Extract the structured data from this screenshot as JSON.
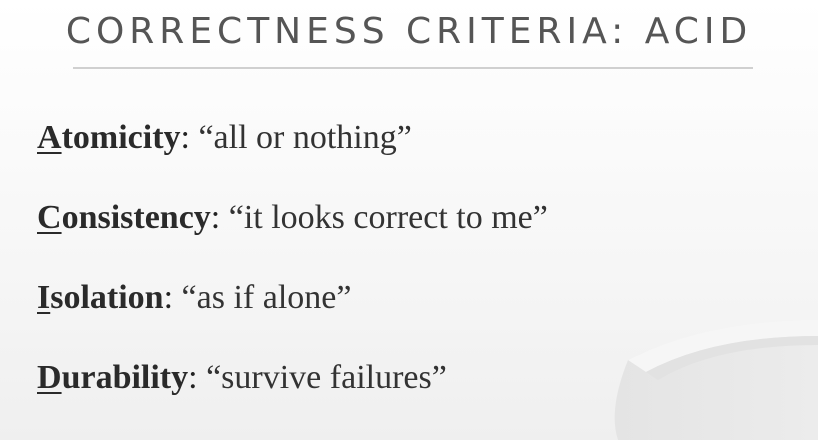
{
  "slide": {
    "title": "CORRECTNESS CRITERIA: ACID",
    "items": [
      {
        "initial": "A",
        "rest": "tomicity",
        "colon": ": ",
        "description": "“all or nothing”"
      },
      {
        "initial": "C",
        "rest": "onsistency",
        "colon": ": ",
        "description": "“it looks correct to me”"
      },
      {
        "initial": "I",
        "rest": "solation",
        "colon": ": ",
        "description": "“as if alone”"
      },
      {
        "initial": "D",
        "rest": "urability",
        "colon": ": ",
        "description": "“survive failures”"
      }
    ]
  }
}
